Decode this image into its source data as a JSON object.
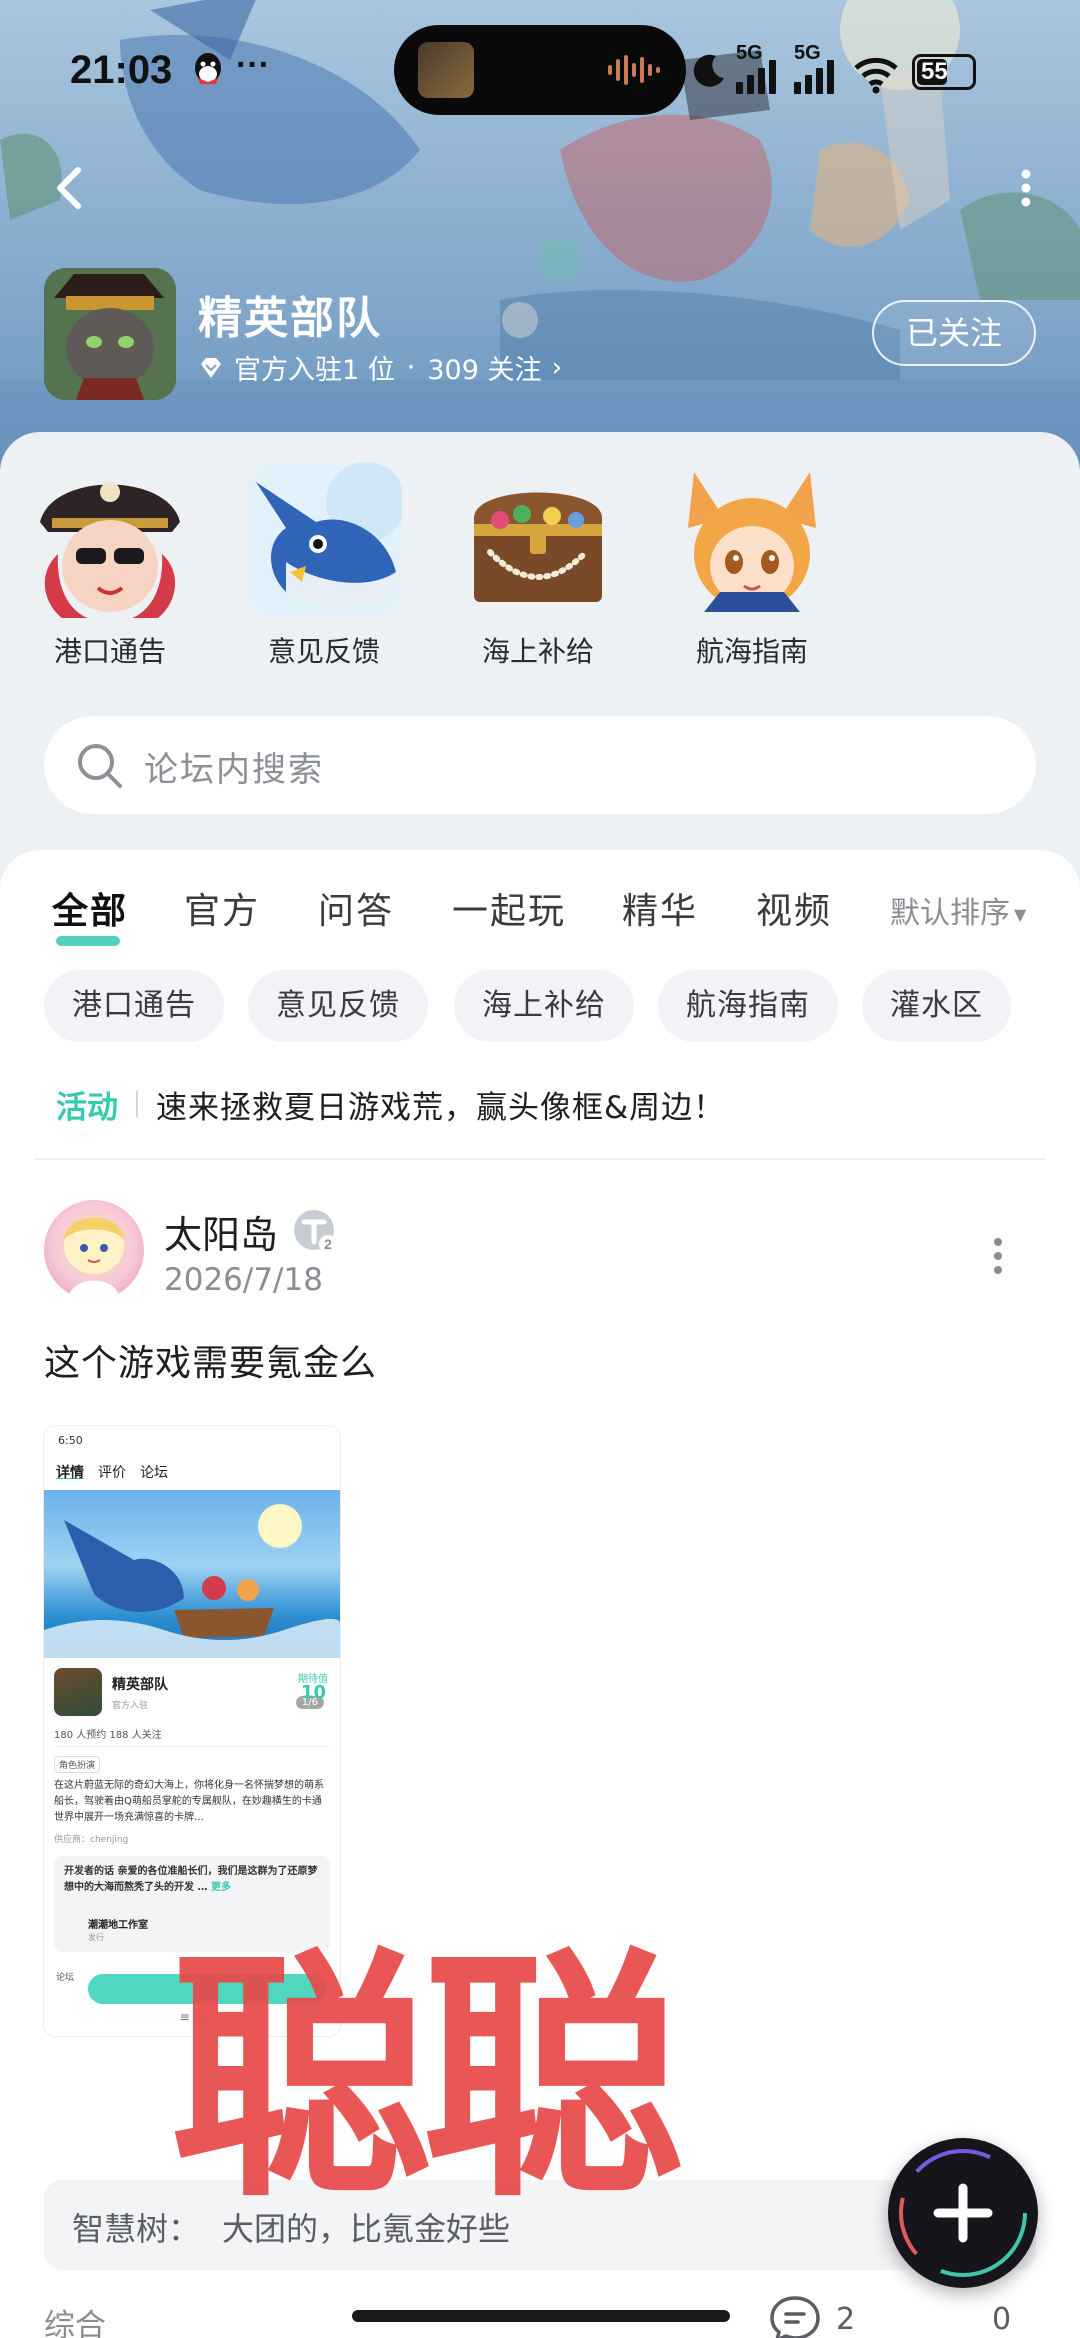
{
  "status_bar": {
    "time": "21:03",
    "dots": "···",
    "network_1": "5G",
    "network_2": "5G",
    "battery": "55"
  },
  "forum": {
    "name": "精英部队",
    "official_text": "官方入驻1 位",
    "separator": "·",
    "followers": "309 关注",
    "chevron": "›",
    "follow_button": "已关注"
  },
  "sections": [
    {
      "label": "港口通告",
      "icon": "pirate-girl-icon"
    },
    {
      "label": "意见反馈",
      "icon": "swordfish-icon"
    },
    {
      "label": "海上补给",
      "icon": "treasure-chest-icon"
    },
    {
      "label": "航海指南",
      "icon": "fox-girl-icon"
    }
  ],
  "search": {
    "placeholder": "论坛内搜索"
  },
  "tabs": {
    "items": [
      "全部",
      "官方",
      "问答",
      "一起玩",
      "精华",
      "视频"
    ],
    "active": "全部",
    "sort_label": "默认排序",
    "sort_arrow": "▼"
  },
  "chips": [
    "港口通告",
    "意见反馈",
    "海上补给",
    "航海指南",
    "灌水区"
  ],
  "activity": {
    "tag": "活动",
    "text": "速来拯救夏日游戏荒，赢头像框&周边！"
  },
  "post": {
    "username": "太阳岛",
    "level": "2",
    "date": "2026/7/18",
    "title": "这个游戏需要氪金么",
    "image": {
      "status_time": "6:50",
      "tabs": [
        "详情",
        "评价",
        "论坛"
      ],
      "counter": "1/6",
      "game_name": "精英部队",
      "official": "官方入驻",
      "score_label": "期待值",
      "score": "10",
      "stats": "180 人预约   188 人关注",
      "genre_tag": "角色扮演",
      "description": "在这片蔚蓝无际的奇幻大海上，你将化身一名怀揣梦想的萌系船长，驾驶着由Q萌船员掌舵的专属舰队，在妙趣横生的卡通世界中展开一场充满惊喜的卡牌…",
      "provider": "供应商：chenjing",
      "dev_words": "开发者的话  亲爱的各位准船长们，我们是这群为了还原梦想中的大海而熬秃了头的开发 …",
      "dev_more": "更多",
      "studio": "潮潮地工作室",
      "studio_role": "发行",
      "bottom_label": "论坛",
      "nav": "≡          ☐"
    },
    "reply": {
      "user": "智慧树：",
      "text": "大团的，比氪金好些"
    },
    "category": "综合",
    "comments": "2",
    "likes": "0"
  },
  "watermark": "聪聪",
  "fab": {
    "icon": "plus-icon"
  },
  "colors": {
    "accent": "#35c9b0",
    "watermark": "#e84a4a",
    "hero_bg": "#7fa7cc"
  }
}
